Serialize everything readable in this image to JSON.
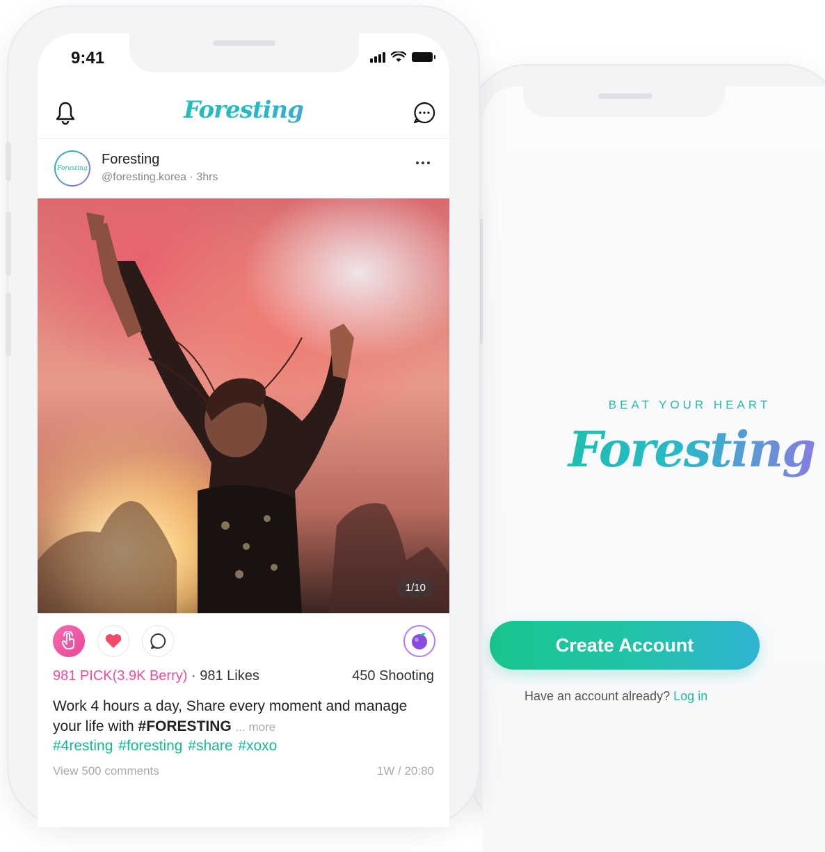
{
  "status_bar": {
    "time": "9:41"
  },
  "app": {
    "logo": "Foresting"
  },
  "post": {
    "author_name": "Foresting",
    "author_handle": "@foresting.korea · 3hrs",
    "avatar_text": "Foresting",
    "photo_counter": "1/10",
    "pick_text": "981 PICK(3.9K Berry)",
    "likes_text": "· 981 Likes",
    "shooting_text": "450 Shooting",
    "caption_text": "Work 4 hours a day, Share every moment and manage your life with ",
    "caption_bold": "#FORESTING",
    "caption_more": "... more",
    "hashtags": "#4resting  #foresting #share #xoxo",
    "view_comments": "View 500 comments",
    "timestamp": "1W / 20:80"
  },
  "welcome": {
    "tagline": "BEAT YOUR HEART",
    "logo": "Foresting",
    "create_account_label": "Create Account",
    "have_account_text": "Have an account already?",
    "login_label": "Log in"
  },
  "colors": {
    "brand_green": "#19c29a",
    "brand_purple": "#9b6fe6",
    "pick_pink": "#ee4d9e",
    "hashtag_green": "#17b894"
  }
}
